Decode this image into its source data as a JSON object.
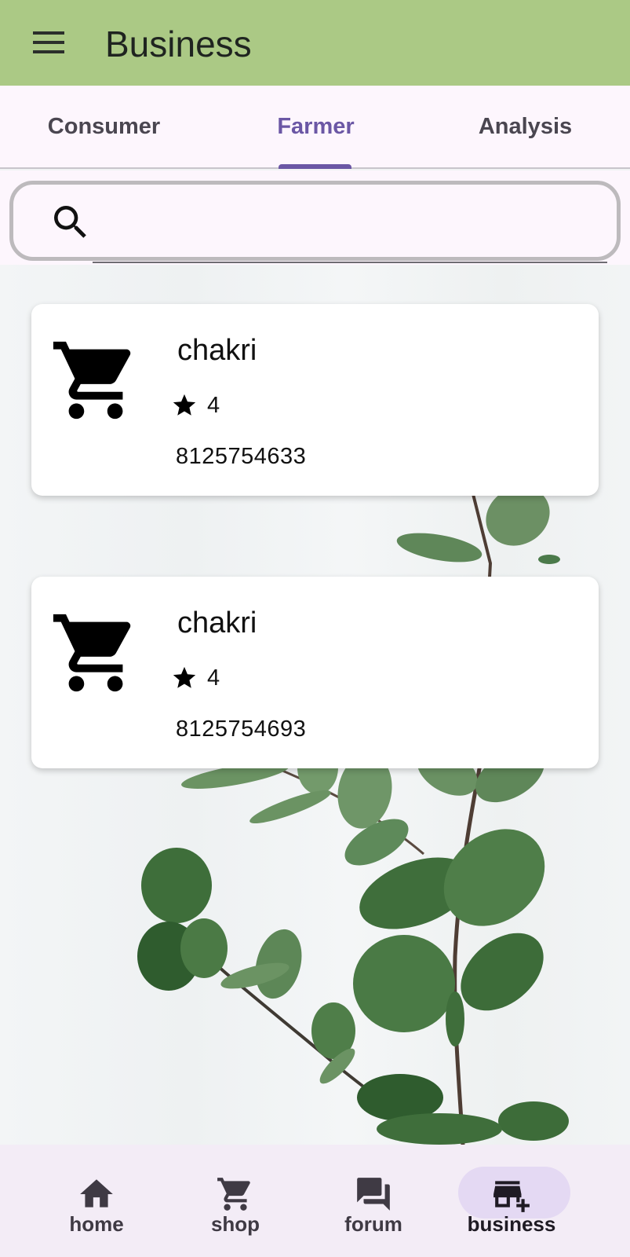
{
  "appbar": {
    "title": "Business",
    "menu_icon": "menu-icon"
  },
  "tabs": [
    {
      "label": "Consumer",
      "active": false
    },
    {
      "label": "Farmer",
      "active": true
    },
    {
      "label": "Analysis",
      "active": false
    }
  ],
  "search": {
    "icon": "search-icon",
    "placeholder": "",
    "value": ""
  },
  "cards": [
    {
      "icon": "cart-icon",
      "name": "chakri",
      "rating": "4",
      "phone": "8125754633"
    },
    {
      "icon": "cart-icon",
      "name": "chakri",
      "rating": "4",
      "phone": "8125754693"
    }
  ],
  "bottom_nav": [
    {
      "label": "home",
      "icon": "home-icon",
      "active": false
    },
    {
      "label": "shop",
      "icon": "cart-icon",
      "active": false
    },
    {
      "label": "forum",
      "icon": "forum-icon",
      "active": false
    },
    {
      "label": "business",
      "icon": "add-business-icon",
      "active": true
    }
  ],
  "colors": {
    "appbar": "#abc985",
    "accent": "#6b57a5",
    "tab_background": "#fdf6fd",
    "nav_background": "#f3ecf6",
    "nav_active_pill": "#e4d9f3"
  }
}
